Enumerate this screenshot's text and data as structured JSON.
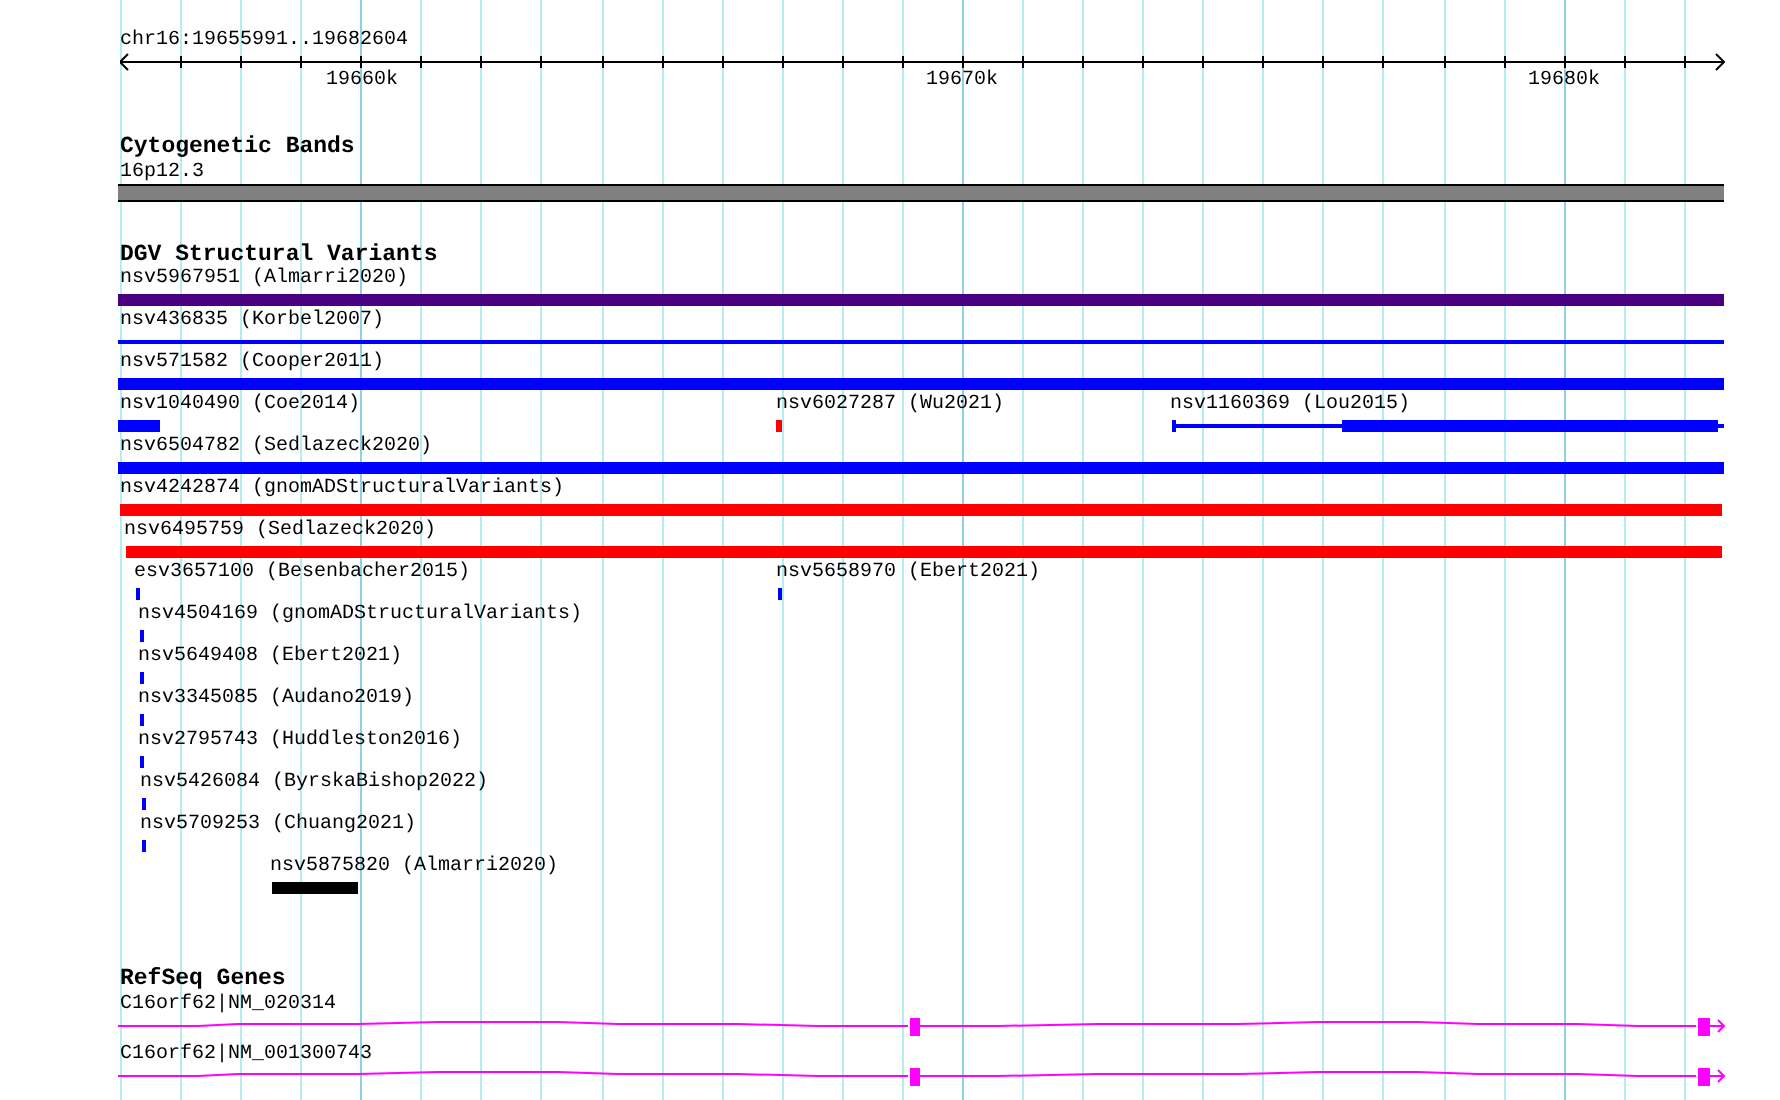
{
  "ruler": {
    "location": "chr16:19655991..19682604",
    "ticks": [
      "19660k",
      "19670k",
      "19680k"
    ]
  },
  "tracks": [
    {
      "kind": "bands",
      "title": "Cytogenetic Bands",
      "features": [
        {
          "label": "16p12.3",
          "color": "#808080"
        }
      ]
    },
    {
      "kind": "variants",
      "title": "DGV Structural Variants",
      "rows": [
        [
          {
            "kind": "bar",
            "label": "nsv5967951 (Almarri2020)",
            "color": "#4b0082"
          }
        ],
        [
          {
            "kind": "line",
            "label": "nsv436835 (Korbel2007)",
            "color": "#0000ff"
          }
        ],
        [
          {
            "kind": "bar",
            "label": "nsv571582 (Cooper2011)",
            "color": "#0000ff"
          }
        ],
        [
          {
            "kind": "bar",
            "label": "nsv1040490 (Coe2014)",
            "color": "#0000ff"
          },
          {
            "kind": "bar",
            "label": "nsv6027287 (Wu2021)",
            "color": "#ff0000"
          },
          {
            "kind": "span",
            "label": "nsv1160369 (Lou2015)",
            "color": "#0000ff"
          }
        ],
        [
          {
            "kind": "bar",
            "label": "nsv6504782 (Sedlazeck2020)",
            "color": "#0000ff"
          }
        ],
        [
          {
            "kind": "bar",
            "label": "nsv4242874 (gnomADStructuralVariants)",
            "color": "#ff0000"
          }
        ],
        [
          {
            "kind": "bar",
            "label": "nsv6495759 (Sedlazeck2020)",
            "color": "#ff0000"
          }
        ],
        [
          {
            "kind": "bar",
            "label": "esv3657100 (Besenbacher2015)",
            "color": "#0000ff"
          },
          {
            "kind": "bar",
            "label": "nsv5658970 (Ebert2021)",
            "color": "#0000ff"
          }
        ],
        [
          {
            "kind": "bar",
            "label": "nsv4504169 (gnomADStructuralVariants)",
            "color": "#0000ff"
          }
        ],
        [
          {
            "kind": "bar",
            "label": "nsv5649408 (Ebert2021)",
            "color": "#0000ff"
          }
        ],
        [
          {
            "kind": "bar",
            "label": "nsv3345085 (Audano2019)",
            "color": "#0000ff"
          }
        ],
        [
          {
            "kind": "bar",
            "label": "nsv2795743 (Huddleston2016)",
            "color": "#0000ff"
          }
        ],
        [
          {
            "kind": "bar",
            "label": "nsv5426084 (ByrskaBishop2022)",
            "color": "#0000ff"
          }
        ],
        [
          {
            "kind": "bar",
            "label": "nsv5709253 (Chuang2021)",
            "color": "#0000ff"
          }
        ],
        [
          {
            "kind": "bar",
            "label": "nsv5875820 (Almarri2020)",
            "color": "#000000"
          }
        ]
      ]
    },
    {
      "kind": "genes",
      "title": "RefSeq Genes",
      "features": [
        {
          "label": "C16orf62|NM_020314",
          "color": "#ff00ff"
        },
        {
          "label": "C16orf62|NM_001300743",
          "color": "#ff00ff"
        }
      ]
    }
  ]
}
